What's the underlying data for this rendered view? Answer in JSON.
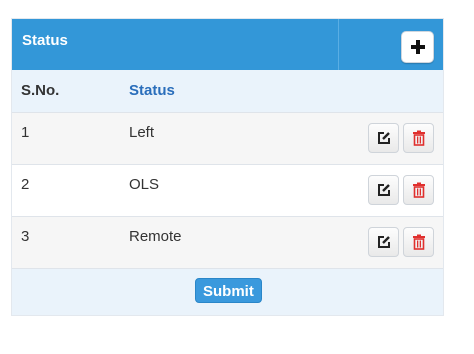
{
  "header": {
    "title": "Status",
    "add_icon": "plus-icon"
  },
  "table": {
    "columns": [
      "S.No.",
      "Status"
    ],
    "rows": [
      {
        "sno": "1",
        "status": "Left"
      },
      {
        "sno": "2",
        "status": "OLS"
      },
      {
        "sno": "3",
        "status": "Remote"
      }
    ],
    "edit_icon": "edit-icon",
    "delete_icon": "trash-icon"
  },
  "footer": {
    "submit_label": "Submit"
  },
  "colors": {
    "header_bg": "#3397d8",
    "accent_text": "#2a6ebb",
    "delete_red": "#e0302e"
  }
}
